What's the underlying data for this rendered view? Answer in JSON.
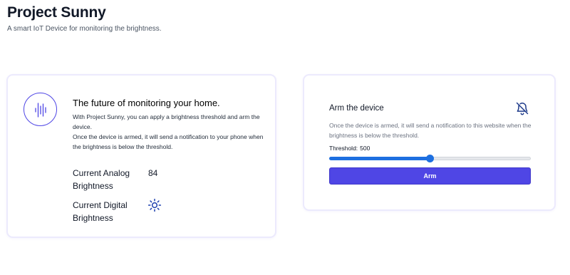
{
  "header": {
    "title": "Project Sunny",
    "subtitle": "A smart IoT Device for monitoring the brightness."
  },
  "monitor_card": {
    "logo_icon": "sound-wave-icon",
    "title": "The future of monitoring your home.",
    "text_line1": "With Project Sunny, you can apply a brightness threshold and arm the device.",
    "text_line2": "Once the device is armed, it will send a notification to your phone when the brightness is below the threshold.",
    "analog_label": "Current Analog Brightness",
    "analog_value": "84",
    "digital_label": "Current Digital Brightness",
    "digital_value_icon": "sun-icon"
  },
  "arm_card": {
    "title": "Arm the device",
    "status_icon": "bell-off-icon",
    "description": "Once the device is armed, it will send a notification to this website when the brightness is below the threshold.",
    "threshold_label": "Threshold:",
    "threshold_value": "500",
    "threshold_fraction": 0.5,
    "button_label": "Arm"
  },
  "colors": {
    "accent": "#4f46e5",
    "slider": "#1d6fe0",
    "card_border": "#eceafd"
  }
}
